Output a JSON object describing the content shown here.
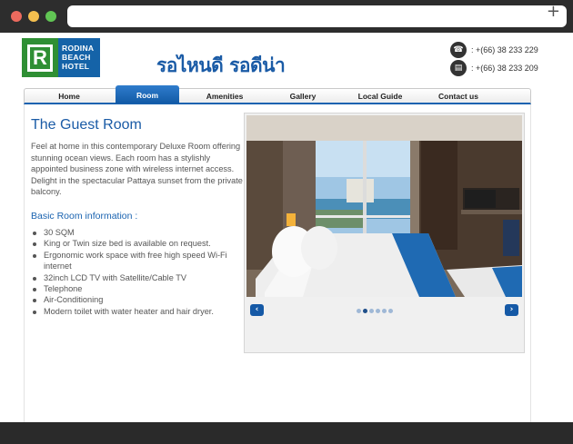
{
  "hotel": {
    "logo_letter": "R",
    "logo_line1": "RODINA",
    "logo_line2": "BEACH",
    "logo_line3": "HOTEL",
    "thai_name": "รอไหนดี  รอดีน่า",
    "brand_colors": {
      "blue": "#1a5ba6",
      "green": "#2f8f34"
    }
  },
  "contact": {
    "phone": ": +(66) 38 233 229",
    "fax": ": +(66) 38 233 209",
    "phone_icon": "phone-icon",
    "fax_icon": "fax-icon"
  },
  "nav": {
    "items": [
      {
        "label": "Home"
      },
      {
        "label": "Room"
      },
      {
        "label": "Amenities"
      },
      {
        "label": "Gallery"
      },
      {
        "label": "Local Guide"
      },
      {
        "label": "Contact us"
      }
    ],
    "active": "Room"
  },
  "content": {
    "title": "The Guest Room",
    "intro": "Feel at home in this contemporary Deluxe Room offering stunning ocean views. Each room has a stylishly appointed business zone with wireless internet access. Delight in the spectacular Pattaya sunset from the private balcony.",
    "basic_heading": "Basic Room information :",
    "features": [
      "30 SQM",
      "King or Twin size bed is available on request.",
      "Ergonomic work space with free high speed Wi-Fi internet",
      "32inch LCD TV with Satellite/Cable TV",
      "Telephone",
      "Air-Conditioning",
      "Modern toilet with water heater and hair dryer."
    ]
  },
  "slider": {
    "prev_label": "‹",
    "next_label": "›",
    "slide_count": 6,
    "current_slide": 2
  }
}
